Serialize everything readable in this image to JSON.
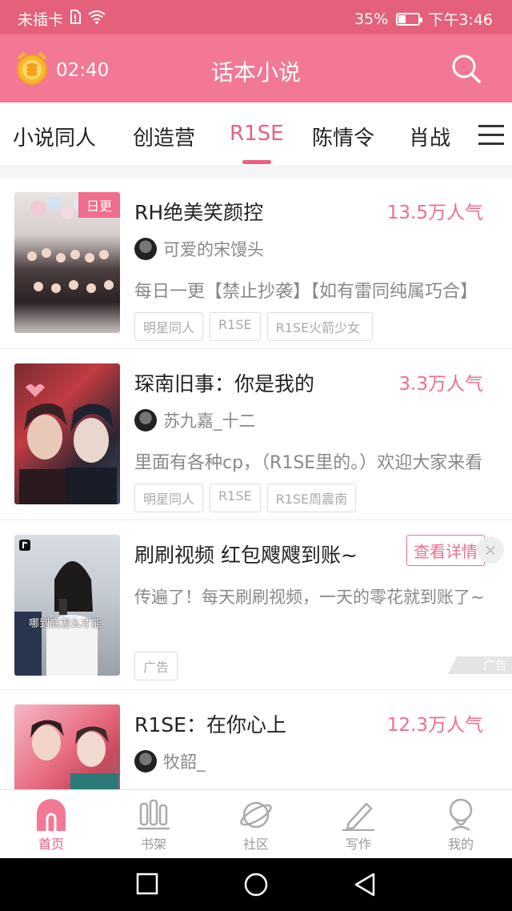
{
  "statusbar": {
    "carrier": "未插卡",
    "battery_text": "35%",
    "battery_level": 0.35,
    "time": "下午3:46"
  },
  "header": {
    "timer": "02:40",
    "title": "话本小说",
    "search_icon": "search-icon"
  },
  "tabs": [
    "小说同人",
    "创造营",
    "R1SE",
    "陈情令",
    "肖战"
  ],
  "active_tab": "R1SE",
  "items": [
    {
      "title": "RH绝美笑颜控",
      "popularity": "13.5万人气",
      "badge": "日更",
      "author": "可爱的宋馒头",
      "description": "每日一更【禁止抄袭】【如有雷同纯属巧合】",
      "tags": [
        "明星同人",
        "R1SE",
        "R1SE火箭少女"
      ]
    },
    {
      "title": "琛南旧事：你是我的",
      "popularity": "3.3万人气",
      "author": "苏九嘉_十二",
      "description": "里面有各种cp，（R1SE里的。）欢迎大家来看",
      "tags": [
        "明星同人",
        "R1SE",
        "R1SE周震南"
      ]
    },
    {
      "title": "R1SE：在你心上",
      "popularity": "12.3万人气",
      "author": "牧韶_"
    }
  ],
  "ad": {
    "title": "刷刷视频 红包飕飕到账~",
    "button": "查看详情",
    "close": "×",
    "description": "传遍了！每天刷刷视频，一天的零花就到账了~",
    "tag": "广告",
    "corner_label": "广告",
    "cover_caption": "哪到底怎么才能"
  },
  "bottom_nav": [
    {
      "label": "首页",
      "icon": "home-icon",
      "active": true
    },
    {
      "label": "书架",
      "icon": "bookshelf-icon",
      "active": false
    },
    {
      "label": "社区",
      "icon": "planet-icon",
      "active": false
    },
    {
      "label": "写作",
      "icon": "pen-icon",
      "active": false
    },
    {
      "label": "我的",
      "icon": "profile-icon",
      "active": false
    }
  ],
  "colors": {
    "status_bar": "#e5607a",
    "app_bar": "#f27895",
    "accent": "#ee5d80"
  }
}
